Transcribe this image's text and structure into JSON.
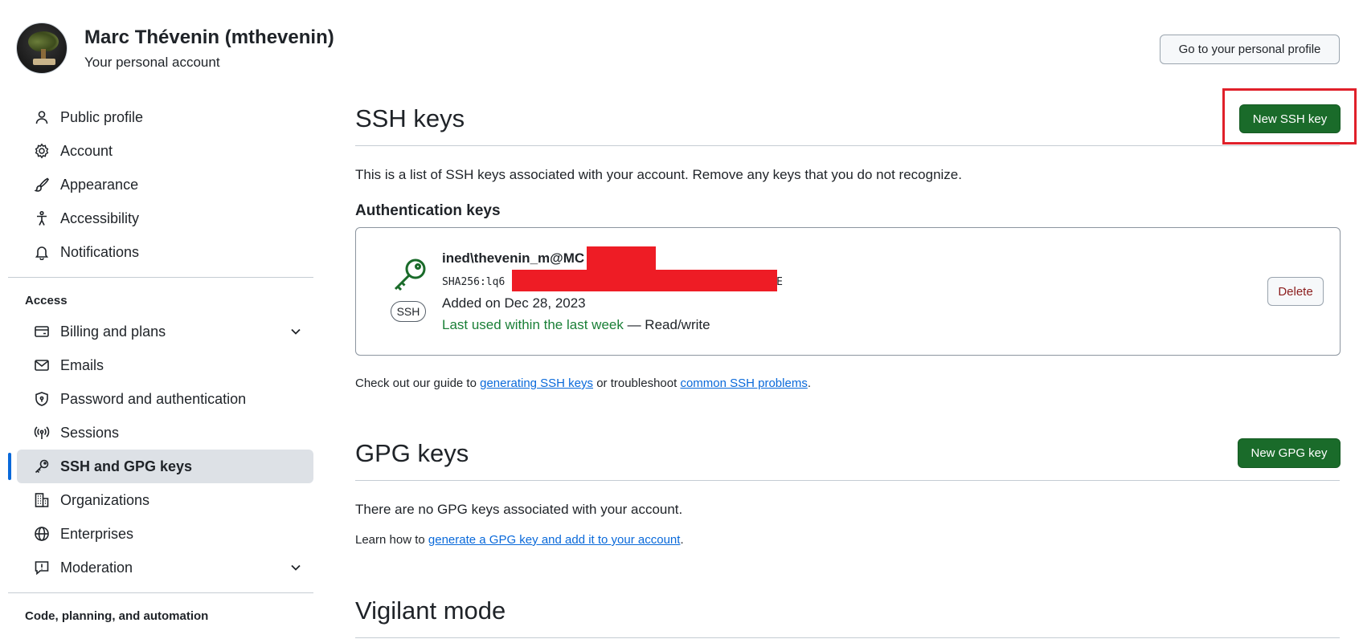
{
  "header": {
    "user_name": "Marc Thévenin (mthevenin)",
    "user_sub": "Your personal account",
    "profile_button": "Go to your personal profile"
  },
  "sidebar": {
    "items_top": [
      {
        "label": "Public profile",
        "icon": "person-icon"
      },
      {
        "label": "Account",
        "icon": "gear-icon"
      },
      {
        "label": "Appearance",
        "icon": "paintbrush-icon"
      },
      {
        "label": "Accessibility",
        "icon": "accessibility-icon"
      },
      {
        "label": "Notifications",
        "icon": "bell-icon"
      }
    ],
    "access_heading": "Access",
    "items_access": [
      {
        "label": "Billing and plans",
        "icon": "credit-card-icon"
      },
      {
        "label": "Emails",
        "icon": "mail-icon"
      },
      {
        "label": "Password and authentication",
        "icon": "shield-lock-icon"
      },
      {
        "label": "Sessions",
        "icon": "broadcast-icon"
      },
      {
        "label": "SSH and GPG keys",
        "icon": "key-icon"
      },
      {
        "label": "Organizations",
        "icon": "organization-icon"
      },
      {
        "label": "Enterprises",
        "icon": "globe-icon"
      },
      {
        "label": "Moderation",
        "icon": "report-icon"
      }
    ],
    "code_heading": "Code, planning, and automation"
  },
  "ssh": {
    "title": "SSH keys",
    "new_button": "New SSH key",
    "description": "This is a list of SSH keys associated with your account. Remove any keys that you do not recognize.",
    "auth_heading": "Authentication keys",
    "key": {
      "badge": "SSH",
      "name": "ined\\thevenin_m@MC",
      "fingerprint_prefix": "SHA256:lq6",
      "fingerprint_suffix": "AE",
      "added": "Added on Dec 28, 2023",
      "last_used": "Last used within the last week",
      "access": " — Read/write",
      "delete_button": "Delete"
    },
    "guide_prefix": "Check out our guide to ",
    "guide_link1": "generating SSH keys",
    "guide_mid": " or troubleshoot ",
    "guide_link2": "common SSH problems",
    "guide_suffix": "."
  },
  "gpg": {
    "title": "GPG keys",
    "new_button": "New GPG key",
    "empty_text": "There are no GPG keys associated with your account.",
    "learn_prefix": "Learn how to ",
    "learn_link": "generate a GPG key and add it to your account",
    "learn_suffix": "."
  },
  "vigilant": {
    "title": "Vigilant mode"
  },
  "colors": {
    "primary_button": "#1a6b2a",
    "link": "#0969da",
    "active_indicator": "#0969da",
    "highlight": "#e0202a",
    "redaction": "#ee1c25",
    "last_used_green": "#1a7f37"
  }
}
